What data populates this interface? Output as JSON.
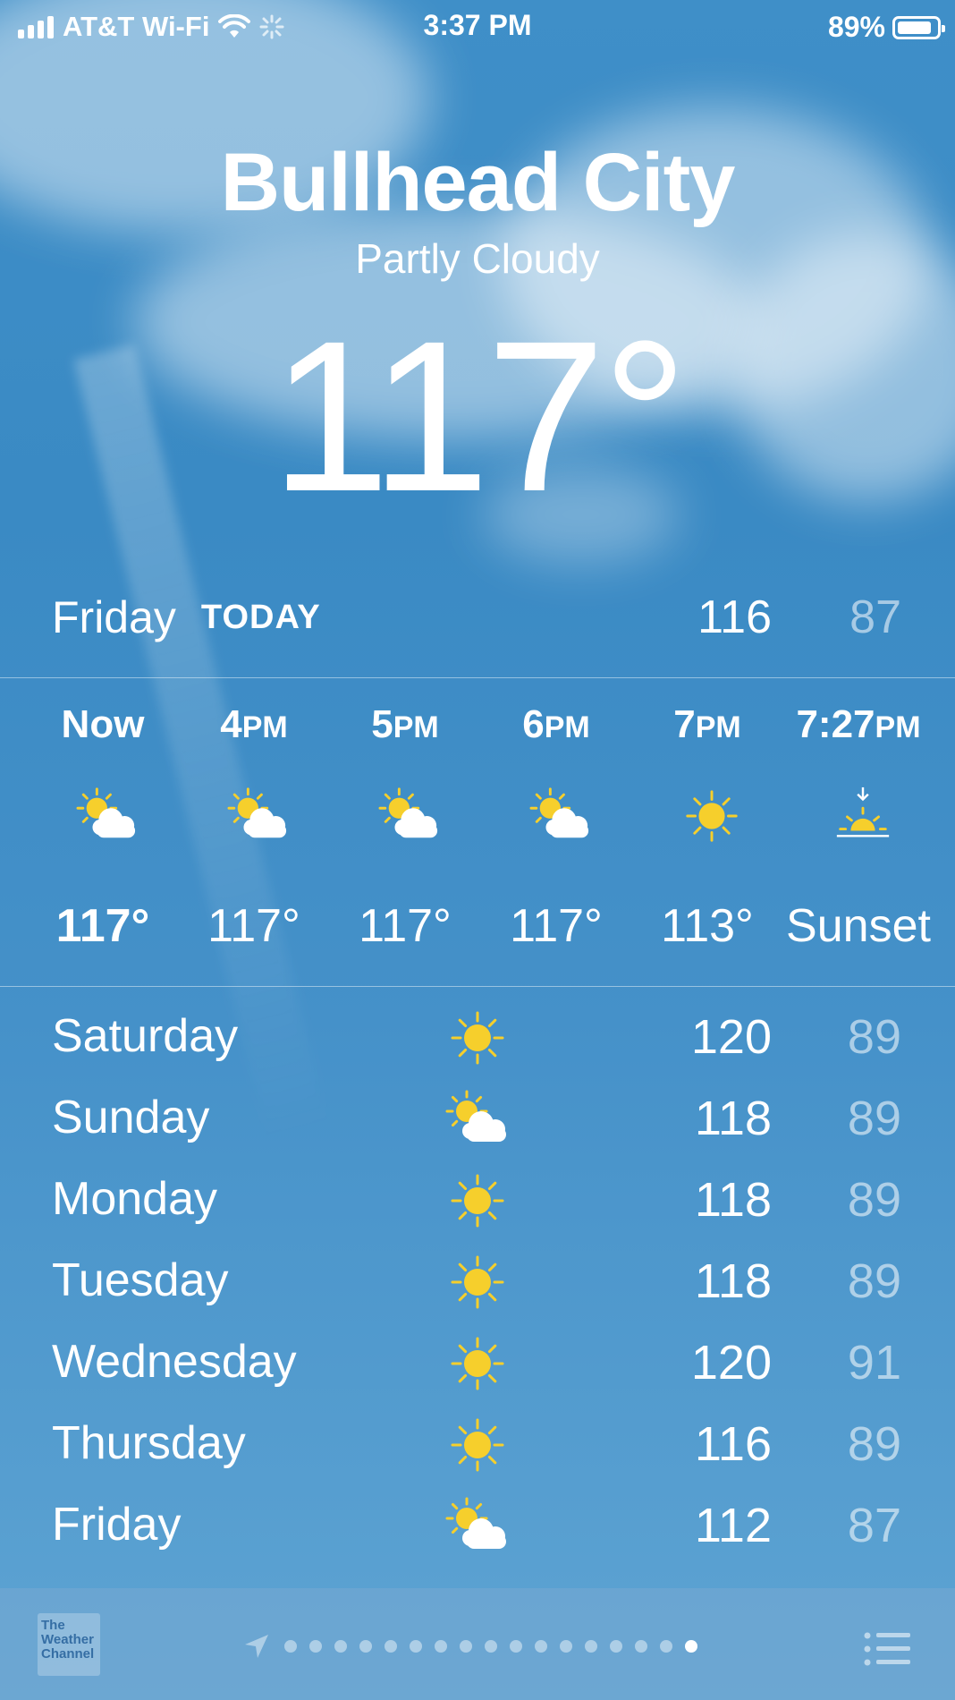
{
  "status_bar": {
    "carrier": "AT&T Wi-Fi",
    "time": "3:37 PM",
    "battery": "89%",
    "battery_level": 0.89
  },
  "location": {
    "city": "Bullhead City",
    "condition": "Partly Cloudy",
    "temperature": "117°"
  },
  "today": {
    "day": "Friday",
    "label": "TODAY",
    "high": "116",
    "low": "87"
  },
  "hourly": [
    {
      "time": "Now",
      "suffix": "",
      "icon": "partly-cloudy-icon",
      "temp": "117°"
    },
    {
      "time": "4",
      "suffix": "PM",
      "icon": "partly-cloudy-icon",
      "temp": "117°"
    },
    {
      "time": "5",
      "suffix": "PM",
      "icon": "partly-cloudy-icon",
      "temp": "117°"
    },
    {
      "time": "6",
      "suffix": "PM",
      "icon": "partly-cloudy-icon",
      "temp": "117°"
    },
    {
      "time": "7",
      "suffix": "PM",
      "icon": "sun-icon",
      "temp": "113°"
    },
    {
      "time": "7:27",
      "suffix": "PM",
      "icon": "sunset-icon",
      "temp": "Sunset"
    }
  ],
  "daily": [
    {
      "day": "Saturday",
      "icon": "sun-icon",
      "high": "120",
      "low": "89"
    },
    {
      "day": "Sunday",
      "icon": "partly-cloudy-icon",
      "high": "118",
      "low": "89"
    },
    {
      "day": "Monday",
      "icon": "sun-icon",
      "high": "118",
      "low": "89"
    },
    {
      "day": "Tuesday",
      "icon": "sun-icon",
      "high": "118",
      "low": "89"
    },
    {
      "day": "Wednesday",
      "icon": "sun-icon",
      "high": "120",
      "low": "91"
    },
    {
      "day": "Thursday",
      "icon": "sun-icon",
      "high": "116",
      "low": "89"
    },
    {
      "day": "Friday",
      "icon": "partly-cloudy-icon",
      "high": "112",
      "low": "87"
    }
  ],
  "bottom_bar": {
    "logo_text": "The Weather Channel",
    "page_count": 17,
    "active_page": 17
  },
  "colors": {
    "sun": "#f6cf2c",
    "sky_top": "#3f8fc8",
    "sky_bottom": "#5ea4d3"
  }
}
